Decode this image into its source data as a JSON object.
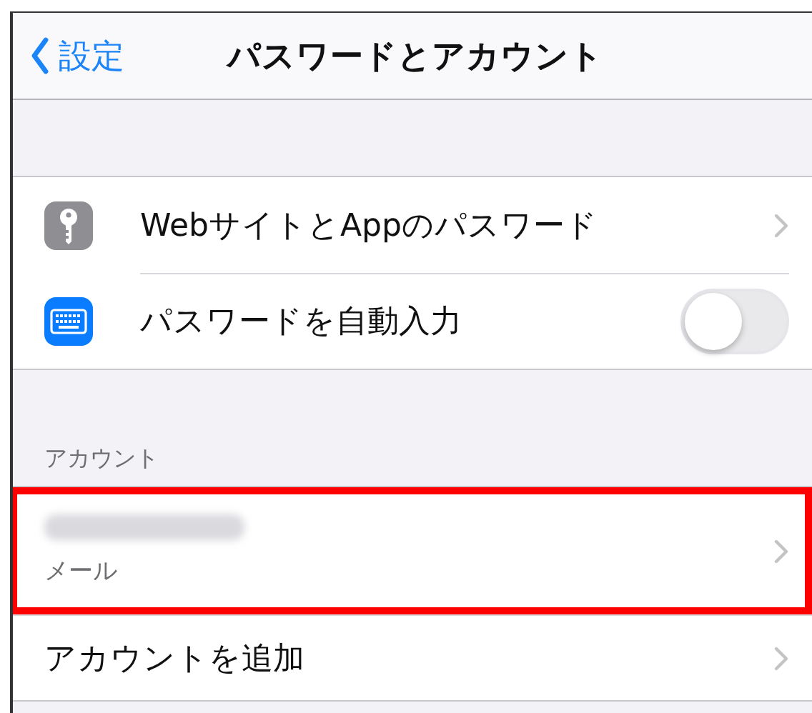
{
  "nav_bar": {
    "back": "設定",
    "title": "パスワードとアカウント"
  },
  "settings_group": [
    {
      "kind": "link",
      "label": "WebサイトとAppのパスワード"
    },
    {
      "kind": "toggle",
      "label": "パスワードを自動入力",
      "on": false
    }
  ],
  "accounts_section": {
    "header": "アカウント",
    "rows": [
      {
        "kind": "account",
        "subtitle": "メール",
        "highlighted": true
      },
      {
        "kind": "add",
        "label": "アカウントを追加",
        "highlighted": false
      }
    ]
  }
}
